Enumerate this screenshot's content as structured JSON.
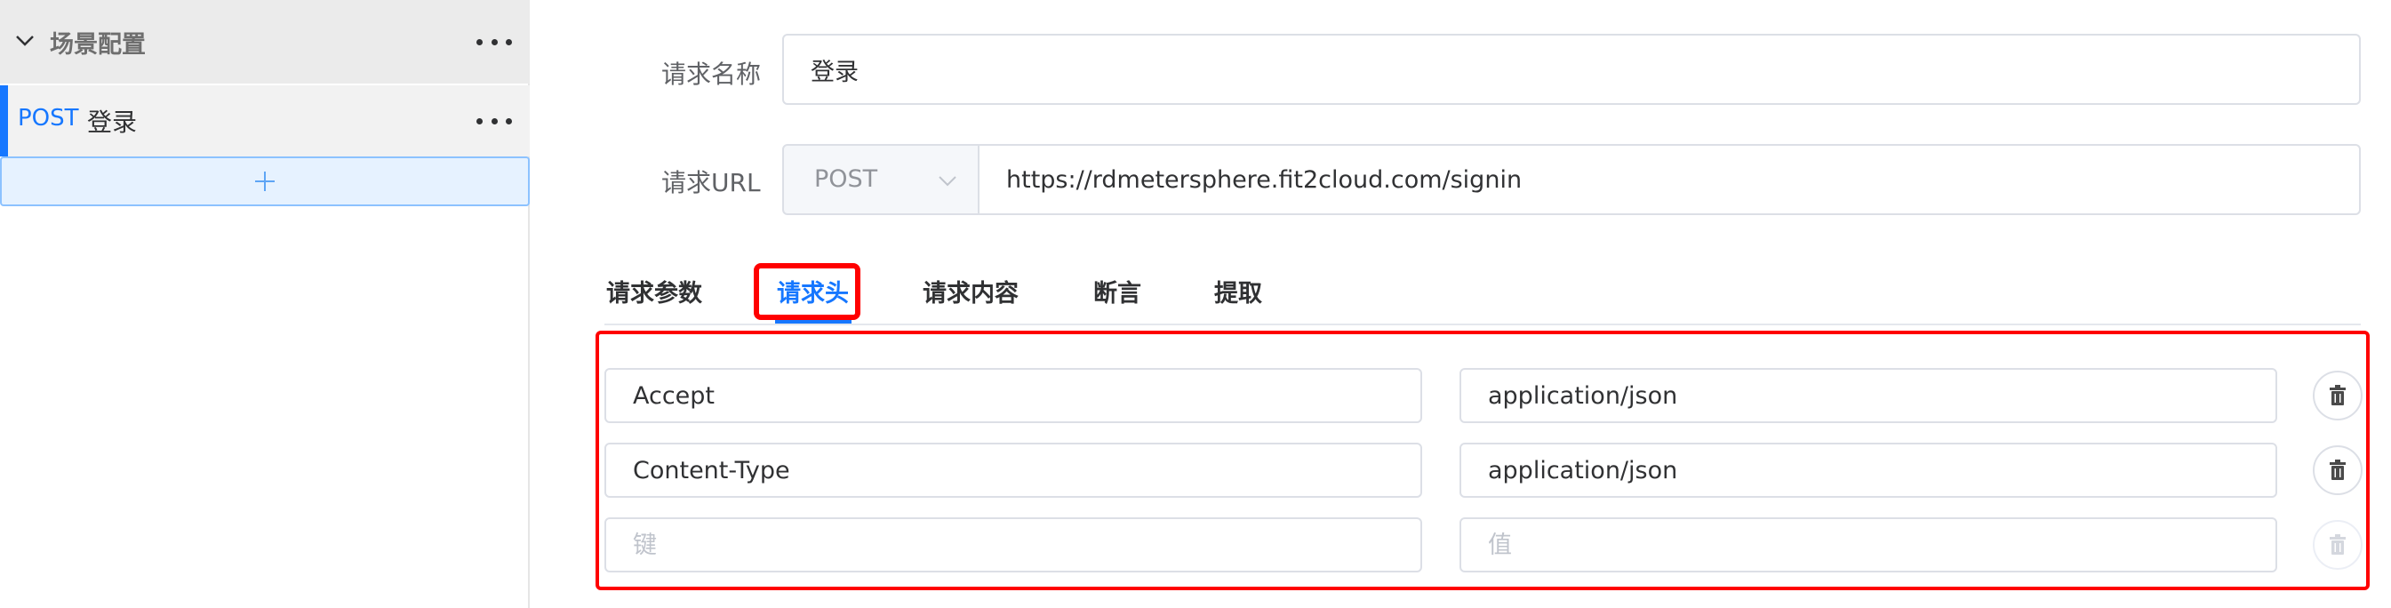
{
  "sidebar": {
    "scenario_title": "场景配置",
    "request": {
      "method": "POST",
      "name": "登录"
    }
  },
  "form": {
    "name_label": "请求名称",
    "name_value": "登录",
    "url_label": "请求URL",
    "method_value": "POST",
    "url_value": "https://rdmetersphere.fit2cloud.com/signin"
  },
  "tabs": [
    {
      "label": "请求参数"
    },
    {
      "label": "请求头"
    },
    {
      "label": "请求内容"
    },
    {
      "label": "断言"
    },
    {
      "label": "提取"
    }
  ],
  "active_tab": "请求头",
  "headers": [
    {
      "key": "Accept",
      "value": "application/json"
    },
    {
      "key": "Content-Type",
      "value": "application/json"
    },
    {
      "key": "",
      "value": ""
    }
  ],
  "placeholders": {
    "key": "键",
    "value": "值"
  },
  "colors": {
    "primary": "#1677ff",
    "annotation": "#ff0000",
    "sidebar_header_bg": "#ebebeb",
    "add_bar_bg": "#e6f2ff"
  },
  "icons": {
    "collapse": "chevron-down-icon",
    "more": "more-horizontal-icon",
    "add": "plus-icon",
    "select": "chevron-down-icon",
    "delete": "trash-icon"
  }
}
